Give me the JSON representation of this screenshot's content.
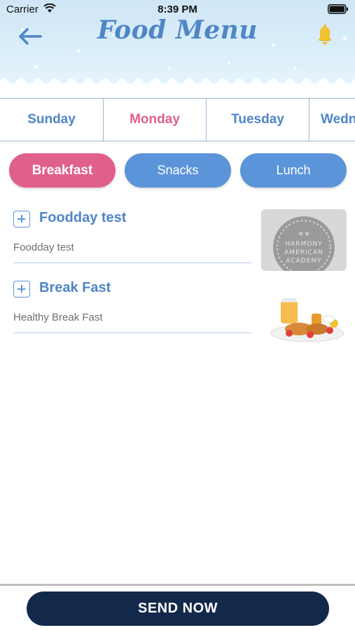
{
  "status_bar": {
    "carrier": "Carrier",
    "time": "8:39 PM"
  },
  "header": {
    "title": "Food Menu",
    "back_icon": "arrow-left-icon",
    "bell_icon": "bell-icon"
  },
  "colors": {
    "accent_blue": "#4f86c6",
    "accent_pink": "#e0608c",
    "pill_blue": "#5b94d9",
    "send_navy": "#13294b"
  },
  "day_tabs": [
    {
      "label": "Sunday",
      "active": false
    },
    {
      "label": "Monday",
      "active": true
    },
    {
      "label": "Tuesday",
      "active": false
    },
    {
      "label": "Wedn",
      "active": false
    }
  ],
  "meal_pills": [
    {
      "label": "Breakfast",
      "active": true
    },
    {
      "label": "Snacks",
      "active": false
    },
    {
      "label": "Lunch",
      "active": false
    }
  ],
  "food_items": [
    {
      "name": "Foodday test",
      "description": "Foodday test",
      "image": "harmony-american-academy-logo"
    },
    {
      "name": "Break Fast",
      "description": "Healthy Break Fast",
      "image": "breakfast-plate-photo"
    }
  ],
  "thumb_logo": {
    "line1": "HARMONY",
    "line2": "AMERICAN",
    "line3": "ACADEMY"
  },
  "send_button": {
    "label": "SEND NOW"
  }
}
